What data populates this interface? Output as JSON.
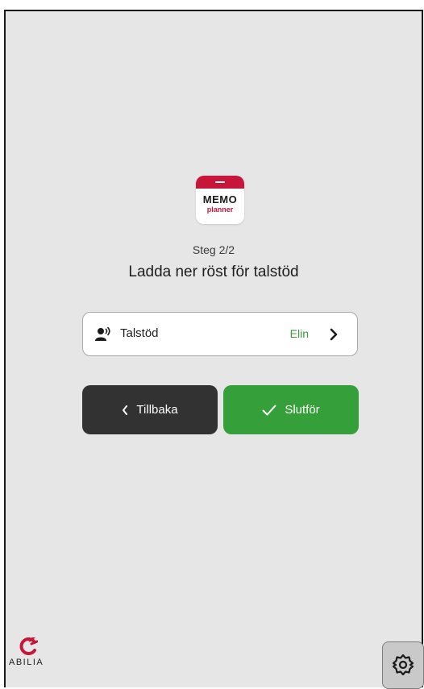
{
  "app_logo": {
    "line1": "MEMO",
    "line2": "planner"
  },
  "step_text": "Steg 2/2",
  "page_title": "Ladda ner röst för talstöd",
  "speech_setting": {
    "label": "Talstöd",
    "value": "Elin",
    "icon": "speech-icon"
  },
  "buttons": {
    "back_label": "Tillbaka",
    "finish_label": "Slutför"
  },
  "brand": {
    "name": "ABILIA"
  },
  "colors": {
    "accent_green": "#35a039",
    "brand_red": "#c8163b",
    "dark_button": "#323232"
  }
}
